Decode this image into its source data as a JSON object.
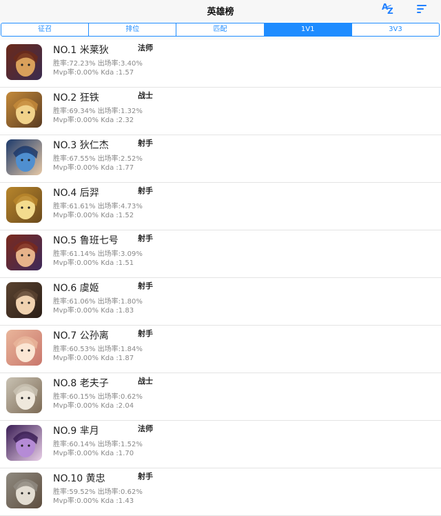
{
  "navbar": {
    "title": "英雄榜",
    "az_icon_letters": [
      "A",
      "Z"
    ],
    "sort_icon": "sort-lines-icon"
  },
  "tabs": [
    {
      "label": "征召",
      "active": false
    },
    {
      "label": "排位",
      "active": false
    },
    {
      "label": "匹配",
      "active": false
    },
    {
      "label": "1V1",
      "active": true
    },
    {
      "label": "3V3",
      "active": false
    }
  ],
  "accent_color": "#1e8cff",
  "heroes": [
    {
      "name": "NO.1 米莱狄",
      "role": "法师",
      "win": "胜率:72.23%",
      "pick": "出场率:3.40%",
      "mvp": "Mvp率:0.00%",
      "kda": "Kda :1.57",
      "colors": [
        "#6b2a1a",
        "#d9a05b",
        "#3a2b4f"
      ]
    },
    {
      "name": "NO.2 狂铁",
      "role": "战士",
      "win": "胜率:69.34%",
      "pick": "出场率:1.32%",
      "mvp": "Mvp率:0.00%",
      "kda": "Kda :2.32",
      "colors": [
        "#c48a3a",
        "#f1d28a",
        "#5a3b21"
      ]
    },
    {
      "name": "NO.3 狄仁杰",
      "role": "射手",
      "win": "胜率:67.55%",
      "pick": "出场率:2.52%",
      "mvp": "Mvp率:0.00%",
      "kda": "Kda :1.77",
      "colors": [
        "#1d3a6b",
        "#4f8fd0",
        "#e7c9a6"
      ]
    },
    {
      "name": "NO.4 后羿",
      "role": "射手",
      "win": "胜率:61.61%",
      "pick": "出场率:4.73%",
      "mvp": "Mvp率:0.00%",
      "kda": "Kda :1.52",
      "colors": [
        "#b8862c",
        "#f3dc8e",
        "#6b4a1c"
      ]
    },
    {
      "name": "NO.5 鲁班七号",
      "role": "射手",
      "win": "胜率:61.14%",
      "pick": "出场率:3.09%",
      "mvp": "Mvp率:0.00%",
      "kda": "Kda :1.51",
      "colors": [
        "#7a2a1d",
        "#e7b38a",
        "#3e2a5a"
      ]
    },
    {
      "name": "NO.6 虞姬",
      "role": "射手",
      "win": "胜率:61.06%",
      "pick": "出场率:1.80%",
      "mvp": "Mvp率:0.00%",
      "kda": "Kda :1.83",
      "colors": [
        "#5a4330",
        "#f0d2b0",
        "#2b1e17"
      ]
    },
    {
      "name": "NO.7 公孙离",
      "role": "射手",
      "win": "胜率:60.53%",
      "pick": "出场率:1.84%",
      "mvp": "Mvp率:0.00%",
      "kda": "Kda :1.87",
      "colors": [
        "#e9b59a",
        "#fbe6d4",
        "#c9776c"
      ]
    },
    {
      "name": "NO.8 老夫子",
      "role": "战士",
      "win": "胜率:60.15%",
      "pick": "出场率:0.62%",
      "mvp": "Mvp率:0.00%",
      "kda": "Kda :2.04",
      "colors": [
        "#c9c2b3",
        "#efe8dc",
        "#7c6a55"
      ]
    },
    {
      "name": "NO.9 芈月",
      "role": "法师",
      "win": "胜率:60.14%",
      "pick": "出场率:1.52%",
      "mvp": "Mvp率:0.00%",
      "kda": "Kda :1.70",
      "colors": [
        "#3b1e55",
        "#b58bd6",
        "#e9cfe8"
      ]
    },
    {
      "name": "NO.10 黄忠",
      "role": "射手",
      "win": "胜率:59.52%",
      "pick": "出场率:0.62%",
      "mvp": "Mvp率:0.00%",
      "kda": "Kda :1.43",
      "colors": [
        "#8f8a80",
        "#e3ddd2",
        "#5d4d3e"
      ]
    }
  ]
}
